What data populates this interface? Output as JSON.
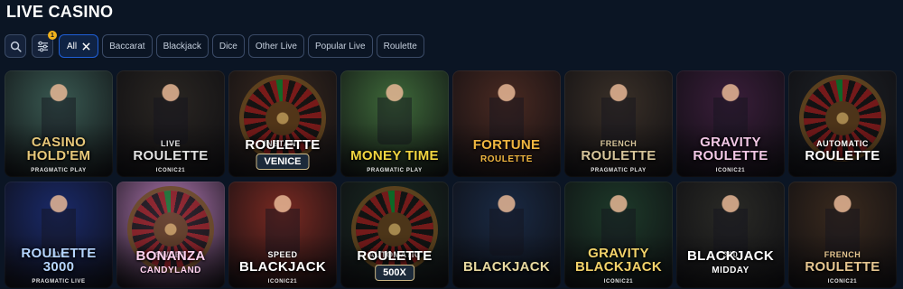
{
  "page": {
    "title": "LIVE CASINO"
  },
  "filters": {
    "badge_count": "1",
    "chips": [
      {
        "label": "All",
        "active": true
      },
      {
        "label": "Baccarat",
        "active": false
      },
      {
        "label": "Blackjack",
        "active": false
      },
      {
        "label": "Dice",
        "active": false
      },
      {
        "label": "Other Live",
        "active": false
      },
      {
        "label": "Popular Live",
        "active": false
      },
      {
        "label": "Roulette",
        "active": false
      }
    ]
  },
  "games": [
    {
      "prefix": "",
      "name": "Casino Hold'em",
      "provider": "PRAGMATIC PLAY",
      "bg": "#3a5a52",
      "accent": "#e7c87a",
      "art": "figure"
    },
    {
      "prefix": "LIVE",
      "name": "ROULETTE",
      "provider": "ICONIC21",
      "bg": "#2a2622",
      "accent": "#e2e2e2",
      "art": "figure"
    },
    {
      "prefix": "INSTANT",
      "name": "ROULETTE",
      "provider": "",
      "pill": "VENICE",
      "bg": "#3a2a20",
      "accent": "#ffffff",
      "art": "wheel"
    },
    {
      "prefix": "",
      "name": "MONEY TIME",
      "provider": "PRAGMATIC PLAY",
      "bg": "#3f6a3a",
      "accent": "#f2d640",
      "art": "figure"
    },
    {
      "prefix": "",
      "name": "Fortune",
      "provider": "PRAGMATIC PLAY",
      "sub": "ROULETTE",
      "bg": "#4a2a22",
      "accent": "#f0b640",
      "art": "figure"
    },
    {
      "prefix": "French",
      "name": "ROULETTE",
      "provider": "PRAGMATIC PLAY",
      "bg": "#3a3028",
      "accent": "#d7c59a",
      "art": "figure"
    },
    {
      "prefix": "",
      "name": "GRAVITY ROULETTE",
      "provider": "ICONIC21",
      "bg": "#3a1e3a",
      "accent": "#f3c8e6",
      "art": "figure"
    },
    {
      "prefix": "AUTOMATIC",
      "name": "ROULETTE",
      "provider": "",
      "bg": "#1f2226",
      "accent": "#ffffff",
      "art": "wheel"
    },
    {
      "prefix": "LIVE",
      "name": "ROULETTE 3000",
      "provider": "PRAGMATIC LIVE",
      "bg": "#1a2a6a",
      "accent": "#b6d6ff",
      "art": "figure"
    },
    {
      "prefix": "SWEET",
      "name": "BONANZA",
      "provider": "",
      "sub": "CANDYLAND",
      "bg": "#b57ab5",
      "accent": "#ffd2ef",
      "art": "wheel"
    },
    {
      "prefix": "SPEED",
      "name": "BLACKJACK",
      "provider": "ICONIC21",
      "bg": "#7a2a22",
      "accent": "#ffffff",
      "art": "figure"
    },
    {
      "prefix": "AUTOMATIC",
      "name": "ROULETTE",
      "provider": "",
      "pill": "500X",
      "bg": "#1a2a22",
      "accent": "#ffffff",
      "art": "wheel"
    },
    {
      "prefix": "",
      "name": "BLACKJACK",
      "provider": "",
      "bg": "#1a2a44",
      "accent": "#e8d9a0",
      "art": "figure"
    },
    {
      "prefix": "",
      "name": "GRAVITY BLACKJACK",
      "provider": "ICONIC21",
      "bg": "#1e3a2a",
      "accent": "#f2d36a",
      "art": "figure"
    },
    {
      "prefix": "360",
      "name": "BLACKJACK",
      "provider": "",
      "sub": "Midday",
      "bg": "#2a2a26",
      "accent": "#ffffff",
      "art": "figure"
    },
    {
      "prefix": "French",
      "name": "ROULETTE",
      "provider": "ICONIC21",
      "bg": "#3a2a1e",
      "accent": "#e6c690",
      "art": "figure"
    }
  ]
}
